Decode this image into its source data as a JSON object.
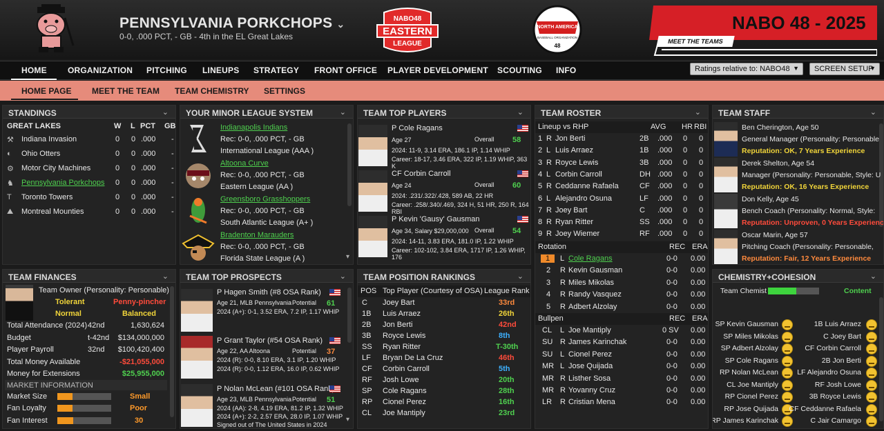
{
  "header": {
    "team_name": "PENNSYLVANIA PORKCHOPS",
    "subtitle": "0-0, .000 PCT, - GB - 4th in the EL Great Lakes",
    "eastern_logo_text": [
      "NABO48",
      "EASTERN",
      "LEAGUE"
    ],
    "nabo_logo_text": [
      "NORTH AMERICA",
      "BASEBALL ORGANIZATION",
      "48"
    ],
    "banner_title": "NABO 48 - 2025",
    "banner_button": "MEET THE TEAMS"
  },
  "nav": {
    "items": [
      "HOME",
      "ORGANIZATION",
      "PITCHING",
      "LINEUPS",
      "STRATEGY",
      "FRONT OFFICE",
      "PLAYER DEVELOPMENT",
      "SCOUTING",
      "INFO"
    ],
    "ratings": "Ratings relative to: NABO48",
    "screen_setup": "SCREEN SETUP",
    "sub": [
      "HOME PAGE",
      "MEET THE TEAM",
      "TEAM CHEMISTRY",
      "SETTINGS"
    ]
  },
  "standings": {
    "title": "STANDINGS",
    "division": "GREAT LAKES",
    "cols": [
      "W",
      "L",
      "PCT",
      "GB"
    ],
    "rows": [
      {
        "team": "Indiana Invasion",
        "w": "0",
        "l": "0",
        "pct": ".000",
        "gb": "-"
      },
      {
        "team": "Ohio Otters",
        "w": "0",
        "l": "0",
        "pct": ".000",
        "gb": "-"
      },
      {
        "team": "Motor City Machines",
        "w": "0",
        "l": "0",
        "pct": ".000",
        "gb": "-"
      },
      {
        "team": "Pennsylvania Porkchops",
        "w": "0",
        "l": "0",
        "pct": ".000",
        "gb": "-"
      },
      {
        "team": "Toronto Towers",
        "w": "0",
        "l": "0",
        "pct": ".000",
        "gb": "-"
      },
      {
        "team": "Montreal Mounties",
        "w": "0",
        "l": "0",
        "pct": ".000",
        "gb": "-"
      }
    ]
  },
  "minors": {
    "title": "YOUR MINOR LEAGUE SYSTEM",
    "teams": [
      {
        "name": "Indianapolis Indians",
        "rec": "Rec: 0-0, .000 PCT, - GB",
        "league": "International League (AAA )"
      },
      {
        "name": "Altoona Curve",
        "rec": "Rec: 0-0, .000 PCT, - GB",
        "league": "Eastern League (AA )"
      },
      {
        "name": "Greensboro Grasshoppers",
        "rec": "Rec: 0-0, .000 PCT, - GB",
        "league": "South Atlantic League (A+ )"
      },
      {
        "name": "Bradenton Marauders",
        "rec": "Rec: 0-0, .000 PCT, - GB",
        "league": "Florida State League (A )"
      }
    ]
  },
  "top_players": {
    "title": "TEAM TOP PLAYERS",
    "overall_label": "Overall",
    "players": [
      {
        "name": "P Cole Ragans",
        "age": "Age 27",
        "overall": "58",
        "l1": "2024: 11-9, 3.14 ERA, 186.1 IP, 1.14 WHIP",
        "l2": "Career: 18-17, 3.46 ERA, 322 IP, 1.19 WHIP, 363 K"
      },
      {
        "name": "CF Corbin Carroll",
        "age": "Age 24",
        "overall": "60",
        "l1": "2024: .231/.322/.428, 589 AB, 22 HR",
        "l2": "Career: .258/.340/.469, 324 H, 51 HR, 250 R, 164 RBI"
      },
      {
        "name": "P Kevin 'Gausy' Gausman",
        "age": "Age 34, Salary $29,000,000",
        "overall": "54",
        "l1": "2024: 14-11, 3.83 ERA, 181.0 IP, 1.22 WHIP",
        "l2": "Career: 102-102, 3.84 ERA, 1717 IP, 1.26 WHIP, 176"
      }
    ]
  },
  "roster": {
    "title": "TEAM ROSTER",
    "lineup_hdr": "Lineup vs RHP",
    "cols": [
      "AVG",
      "HR",
      "RBI"
    ],
    "lineup": [
      {
        "n": "1",
        "h": "R",
        "name": "Jon Berti",
        "pos": "2B",
        "avg": ".000",
        "hr": "0",
        "rbi": "0"
      },
      {
        "n": "2",
        "h": "L",
        "name": "Luis Arraez",
        "pos": "1B",
        "avg": ".000",
        "hr": "0",
        "rbi": "0"
      },
      {
        "n": "3",
        "h": "R",
        "name": "Royce Lewis",
        "pos": "3B",
        "avg": ".000",
        "hr": "0",
        "rbi": "0"
      },
      {
        "n": "4",
        "h": "L",
        "name": "Corbin Carroll",
        "pos": "DH",
        "avg": ".000",
        "hr": "0",
        "rbi": "0"
      },
      {
        "n": "5",
        "h": "R",
        "name": "Ceddanne Rafaela",
        "pos": "CF",
        "avg": ".000",
        "hr": "0",
        "rbi": "0"
      },
      {
        "n": "6",
        "h": "L",
        "name": "Alejandro Osuna",
        "pos": "LF",
        "avg": ".000",
        "hr": "0",
        "rbi": "0"
      },
      {
        "n": "7",
        "h": "R",
        "name": "Joey Bart",
        "pos": "C",
        "avg": ".000",
        "hr": "0",
        "rbi": "0"
      },
      {
        "n": "8",
        "h": "R",
        "name": "Ryan Ritter",
        "pos": "SS",
        "avg": ".000",
        "hr": "0",
        "rbi": "0"
      },
      {
        "n": "9",
        "h": "R",
        "name": "Joey Wiemer",
        "pos": "RF",
        "avg": ".000",
        "hr": "0",
        "rbi": "0"
      }
    ],
    "rotation_hdr": "Rotation",
    "pcols": [
      "REC",
      "ERA"
    ],
    "rotation": [
      {
        "n": "1",
        "h": "L",
        "name": "Cole Ragans",
        "rec": "0-0",
        "era": "0.00"
      },
      {
        "n": "2",
        "h": "R",
        "name": "Kevin Gausman",
        "rec": "0-0",
        "era": "0.00"
      },
      {
        "n": "3",
        "h": "R",
        "name": "Miles Mikolas",
        "rec": "0-0",
        "era": "0.00"
      },
      {
        "n": "4",
        "h": "R",
        "name": "Randy Vasquez",
        "rec": "0-0",
        "era": "0.00"
      },
      {
        "n": "5",
        "h": "R",
        "name": "Adbert Alzolay",
        "rec": "0-0",
        "era": "0.00"
      }
    ],
    "bullpen_hdr": "Bullpen",
    "bullpen": [
      {
        "n": "CL",
        "h": "L",
        "name": "Joe Mantiply",
        "rec": "0 SV",
        "era": "0.00"
      },
      {
        "n": "SU",
        "h": "R",
        "name": "James Karinchak",
        "rec": "0-0",
        "era": "0.00"
      },
      {
        "n": "SU",
        "h": "L",
        "name": "Cionel Perez",
        "rec": "0-0",
        "era": "0.00"
      },
      {
        "n": "MR",
        "h": "L",
        "name": "Jose Quijada",
        "rec": "0-0",
        "era": "0.00"
      },
      {
        "n": "MR",
        "h": "R",
        "name": "Listher Sosa",
        "rec": "0-0",
        "era": "0.00"
      },
      {
        "n": "MR",
        "h": "R",
        "name": "Yovanny Cruz",
        "rec": "0-0",
        "era": "0.00"
      },
      {
        "n": "LR",
        "h": "R",
        "name": "Cristian Mena",
        "rec": "0-0",
        "era": "0.00"
      }
    ]
  },
  "staff": {
    "title": "TEAM STAFF",
    "members": [
      {
        "name": "Ben Cherington, Age 50",
        "role": "General Manager (Personality: Personable",
        "rep": "Reputation: OK, 7 Years Experience",
        "c": "#f0d43a"
      },
      {
        "name": "Derek Shelton, Age 54",
        "role": "Manager (Personality: Personable, Style: U",
        "rep": "Reputation: OK, 16 Years Experience",
        "c": "#f0d43a"
      },
      {
        "name": "Don Kelly, Age 45",
        "role": "Bench Coach (Personality: Normal, Style:",
        "rep": "Reputation: Unproven, 0 Years Experience",
        "c": "#ff4b3b"
      },
      {
        "name": "Oscar Marin, Age 57",
        "role": "Pitching Coach (Personality: Personable,",
        "rep": "Reputation: Fair, 12 Years Experience",
        "c": "#ff8a3d"
      }
    ]
  },
  "finances": {
    "title": "TEAM FINANCES",
    "owner": "Team Owner (Personality: Personable)",
    "traits": [
      "Tolerant",
      "Penny-pincher",
      "Normal",
      "Balanced"
    ],
    "rows": [
      {
        "label": "Total Attendance (2024)",
        "rank": "42nd",
        "value": "1,630,624",
        "c": "#e8e8e8"
      },
      {
        "label": "Budget",
        "rank": "t-42nd",
        "value": "$134,000,000",
        "c": "#e8e8e8"
      },
      {
        "label": "Player Payroll",
        "rank": "32nd",
        "value": "$100,420,400",
        "c": "#e8e8e8"
      },
      {
        "label": "Total Money Available",
        "rank": "",
        "value": "-$21,055,000",
        "c": "#ff4b3b"
      },
      {
        "label": "Money for Extensions",
        "rank": "",
        "value": "$25,955,000",
        "c": "#4fd14f"
      }
    ],
    "market_hdr": "MARKET INFORMATION",
    "market": [
      {
        "label": "Market Size",
        "value": "Small",
        "level": 0.28
      },
      {
        "label": "Fan Loyalty",
        "value": "Poor",
        "level": 0.28
      },
      {
        "label": "Fan Interest",
        "value": "30",
        "level": 0.3
      }
    ]
  },
  "prospects": {
    "title": "TEAM TOP PROSPECTS",
    "pot_label": "Potential",
    "players": [
      {
        "name": "P Hagen Smith (#8 OSA Rank)",
        "sub": "Age 21, MLB Pennsylvania",
        "pot": "61",
        "pc": "#4fd14f",
        "l1": "2024 (A+): 0-1, 3.52 ERA, 7.2 IP, 1.17 WHIP",
        "l2": ""
      },
      {
        "name": "P Grant Taylor (#54 OSA Rank)",
        "sub": "2024 (R): 0-0, 8.10 ERA, 3.1 IP, 1.20 WHIP",
        "pot": "37",
        "pc": "#ff8a3d",
        "l1": "2024 (R): 0-0, 1.12 ERA, 16.0 IP, 0.62 WHIP",
        "l2": "",
        "sub2": "Age 22, AA Altoona"
      },
      {
        "name": "P Nolan McLean (#101 OSA Rank)",
        "sub": "Age 23, MLB Pennsylvania",
        "pot": "51",
        "pc": "#4fd14f",
        "l1": "2024 (AA): 2-8, 4.19 ERA, 81.2 IP, 1.32 WHIP",
        "l2": "2024 (A+): 2-2, 2.57 ERA, 28.0 IP, 1.07 WHIP",
        "l3": "Signed out of The United States in 2024"
      }
    ]
  },
  "rankings": {
    "title": "TEAM POSITION RANKINGS",
    "cols": [
      "POS",
      "Top Player (Courtesy of OSA)",
      "League Rank"
    ],
    "rows": [
      {
        "pos": "C",
        "player": "Joey Bart",
        "rank": "33rd",
        "c": "#ff8a3d"
      },
      {
        "pos": "1B",
        "player": "Luis Arraez",
        "rank": "26th",
        "c": "#f0d43a"
      },
      {
        "pos": "2B",
        "player": "Jon Berti",
        "rank": "42nd",
        "c": "#ff4b3b"
      },
      {
        "pos": "3B",
        "player": "Royce Lewis",
        "rank": "8th",
        "c": "#3db0ff"
      },
      {
        "pos": "SS",
        "player": "Ryan Ritter",
        "rank": "T-30th",
        "c": "#4fd14f"
      },
      {
        "pos": "LF",
        "player": "Bryan De La Cruz",
        "rank": "46th",
        "c": "#ff4b3b"
      },
      {
        "pos": "CF",
        "player": "Corbin Carroll",
        "rank": "5th",
        "c": "#3db0ff"
      },
      {
        "pos": "RF",
        "player": "Josh Lowe",
        "rank": "20th",
        "c": "#4fd14f"
      },
      {
        "pos": "SP",
        "player": "Cole Ragans",
        "rank": "28th",
        "c": "#4fd14f"
      },
      {
        "pos": "RP",
        "player": "Cionel Perez",
        "rank": "16th",
        "c": "#4fd14f"
      },
      {
        "pos": "CL",
        "player": "Joe Mantiply",
        "rank": "23rd",
        "c": "#4fd14f"
      }
    ]
  },
  "chemistry": {
    "title": "CHEMISTRY+COHESION",
    "label": "Team Chemist",
    "status": "Content",
    "level": 0.55,
    "left": [
      "SP Kevin Gausman",
      "SP Miles Mikolas",
      "SP Adbert Alzolay",
      "SP Cole Ragans",
      "RP Nolan McLean",
      "CL Joe Mantiply",
      "RP Cionel Perez",
      "RP Jose Quijada",
      "RP James Karinchak"
    ],
    "right": [
      "1B Luis Arraez",
      "C Joey Bart",
      "CF Corbin Carroll",
      "2B Jon Berti",
      "LF Alejandro Osuna",
      "RF Josh Lowe",
      "3B Royce Lewis",
      "CF Ceddanne Rafaela",
      "C Jair Camargo"
    ]
  }
}
